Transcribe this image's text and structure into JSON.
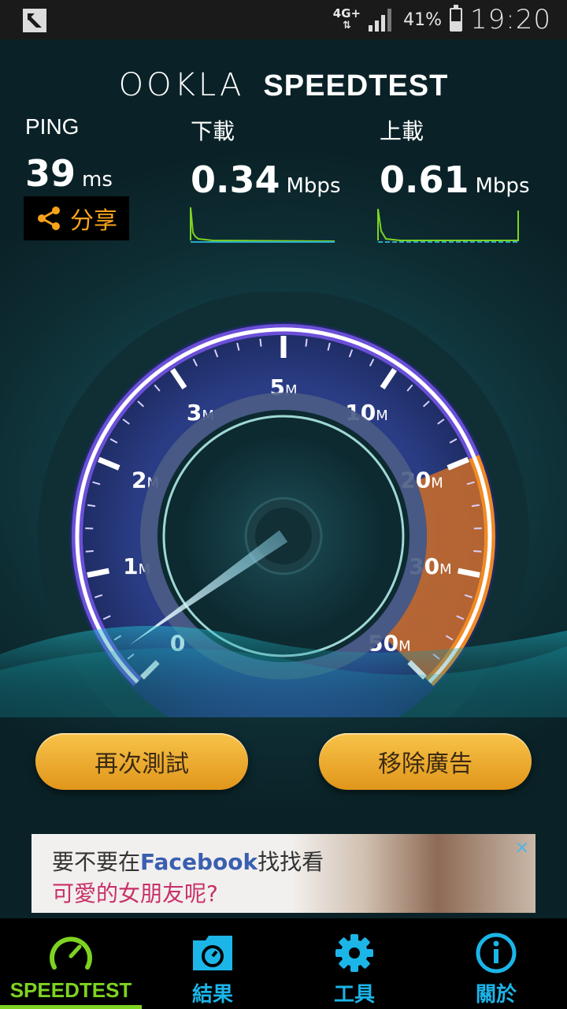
{
  "status_bar": {
    "network": "4G+",
    "battery_percent": "41%",
    "battery_level": 0.41,
    "time": "19:20"
  },
  "brand": {
    "logo": "OOKLA",
    "product": "SPEEDTEST"
  },
  "metrics": {
    "ping": {
      "label": "PING",
      "value": "39",
      "unit": "ms"
    },
    "download": {
      "label": "下載",
      "value": "0.34",
      "unit": "Mbps"
    },
    "upload": {
      "label": "上載",
      "value": "0.61",
      "unit": "Mbps"
    }
  },
  "share": {
    "label": "分享",
    "icon": "share-icon"
  },
  "gauge": {
    "ticks": [
      {
        "num": "0",
        "unit": ""
      },
      {
        "num": "1",
        "unit": "M"
      },
      {
        "num": "2",
        "unit": "M"
      },
      {
        "num": "3",
        "unit": "M"
      },
      {
        "num": "5",
        "unit": "M"
      },
      {
        "num": "10",
        "unit": "M"
      },
      {
        "num": "20",
        "unit": "M"
      },
      {
        "num": "30",
        "unit": "M"
      },
      {
        "num": "50",
        "unit": "M"
      }
    ],
    "colors": {
      "low": "#6b4fd8",
      "high": "#f08a24"
    }
  },
  "buttons": {
    "retest": "再次測試",
    "remove_ads": "移除廣告"
  },
  "ad": {
    "line1_prefix": "要不要在",
    "line1_brand": "Facebook",
    "line1_suffix": "找找看",
    "line2": "可愛的女朋友呢?"
  },
  "nav": [
    {
      "label": "SPEEDTEST",
      "icon": "speedometer-icon",
      "active": true
    },
    {
      "label": "結果",
      "icon": "results-folder-icon",
      "active": false
    },
    {
      "label": "工具",
      "icon": "gear-icon",
      "active": false
    },
    {
      "label": "關於",
      "icon": "info-icon",
      "active": false
    }
  ]
}
